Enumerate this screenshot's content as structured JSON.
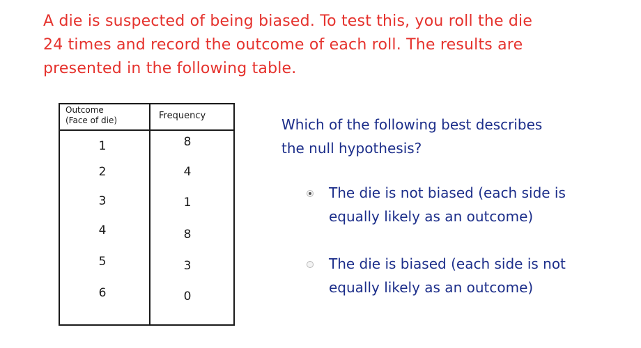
{
  "problem": {
    "lines": [
      "A die is suspected of being biased. To test this, you roll the die",
      "24 times and record the outcome of each roll. The results are",
      "presented in the following table."
    ]
  },
  "table": {
    "header_outcome_line1": "Outcome",
    "header_outcome_line2": "(Face of die)",
    "header_frequency": "Frequency",
    "rows": [
      {
        "outcome": "1",
        "frequency": "8"
      },
      {
        "outcome": "2",
        "frequency": "4"
      },
      {
        "outcome": "3",
        "frequency": "1"
      },
      {
        "outcome": "4",
        "frequency": "8"
      },
      {
        "outcome": "5",
        "frequency": "3"
      },
      {
        "outcome": "6",
        "frequency": "0"
      }
    ]
  },
  "question": {
    "line1": "Which of the following best describes",
    "line2": "the null hypothesis?"
  },
  "options": [
    {
      "line1": "The die is not biased (each side is",
      "line2": "equally likely as an outcome)",
      "selected": true
    },
    {
      "line1": "The die is biased (each side is not",
      "line2": "equally likely as an outcome)",
      "selected": false
    }
  ],
  "colors": {
    "problem_text": "#e5322d",
    "question_text": "#1c2e8a",
    "table_ink": "#1a1a1a"
  }
}
